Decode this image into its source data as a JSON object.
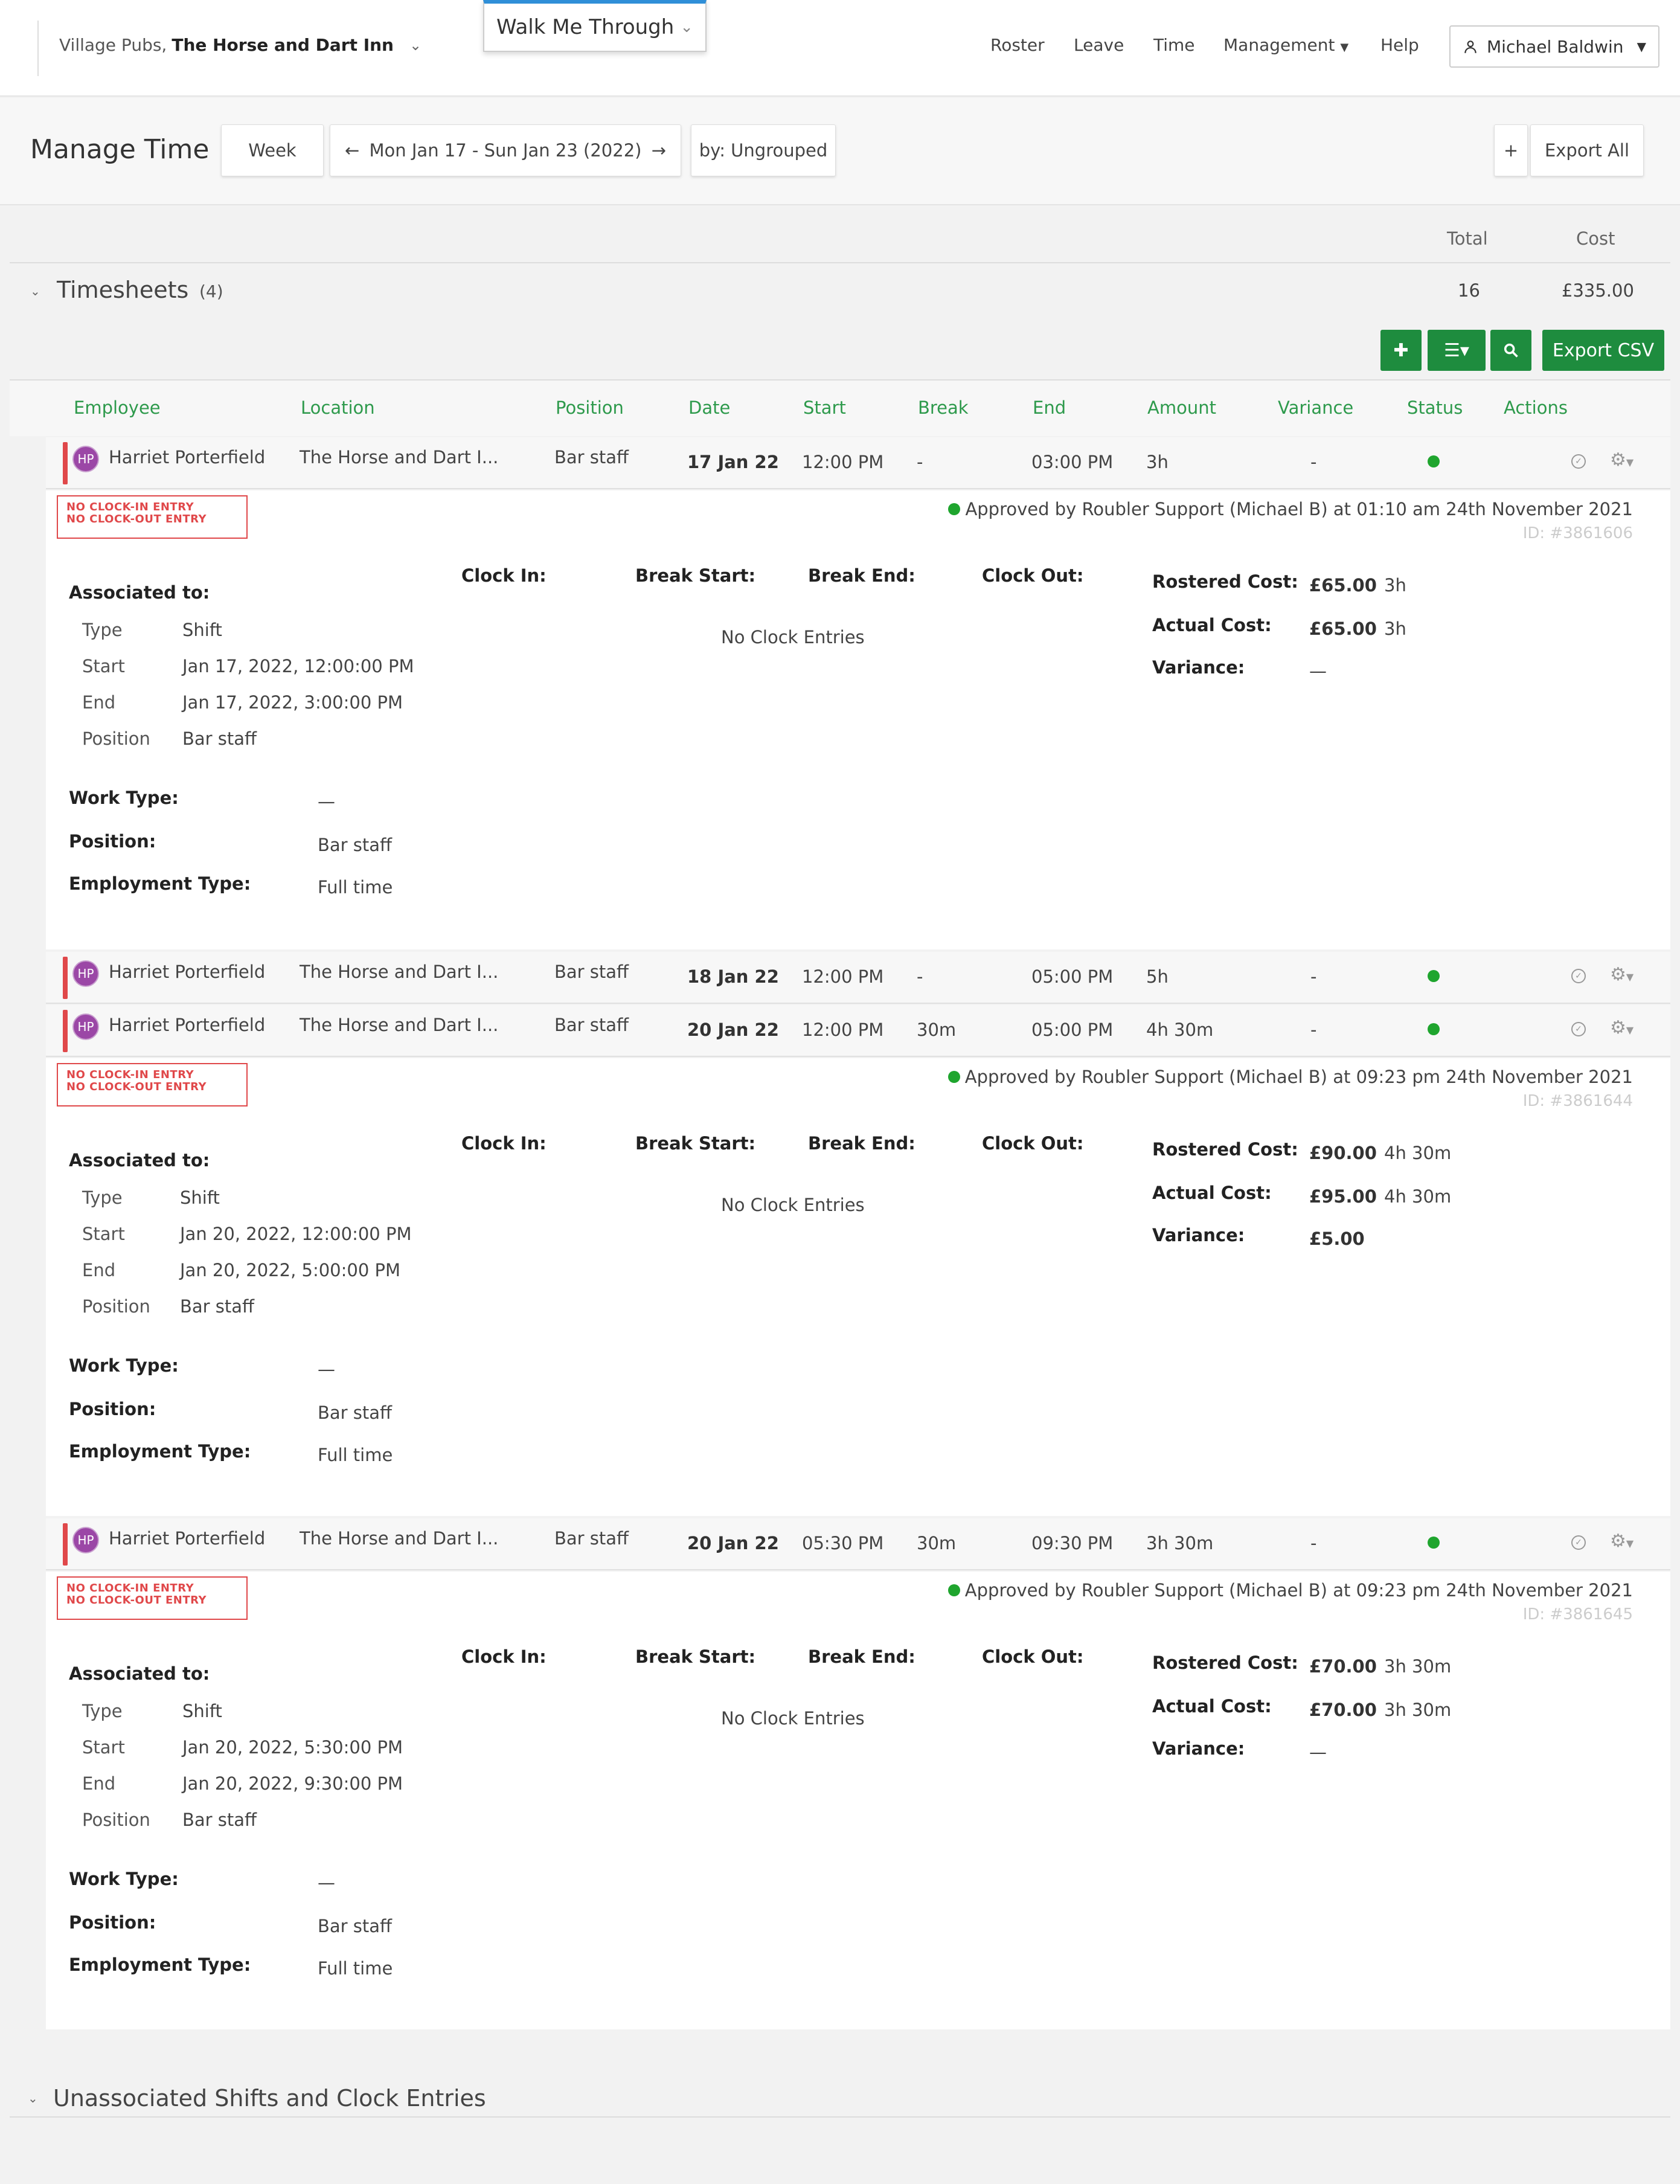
{
  "topnav": {
    "org_prefix": "Village Pubs,",
    "org_name": "The Horse and Dart Inn",
    "walk_me": "Walk Me Through",
    "links": {
      "roster": "Roster",
      "leave": "Leave",
      "time": "Time",
      "management": "Management",
      "help": "Help"
    },
    "user": "Michael Baldwin"
  },
  "header": {
    "title": "Manage Time",
    "view": "Week",
    "date_range": "Mon Jan 17 - Sun Jan 23 (2022)",
    "group_by": "by: Ungrouped",
    "plus": "+",
    "export_all": "Export All"
  },
  "summary": {
    "total_label": "Total",
    "cost_label": "Cost",
    "section_title": "Timesheets",
    "count": "(4)",
    "total": "16",
    "cost": "£335.00",
    "export_csv": "Export CSV"
  },
  "columns": [
    "Employee",
    "Location",
    "Position",
    "Date",
    "Start",
    "Break",
    "End",
    "Amount",
    "Variance",
    "Status",
    "Actions"
  ],
  "rows": [
    {
      "initials": "HP",
      "employee": "Harriet Porterfield",
      "location": "The Horse and Dart I...",
      "position": "Bar staff",
      "date": "17 Jan 22",
      "start": "12:00 PM",
      "break": "-",
      "end": "03:00 PM",
      "amount": "3h",
      "variance": "-"
    },
    {
      "initials": "HP",
      "employee": "Harriet Porterfield",
      "location": "The Horse and Dart I...",
      "position": "Bar staff",
      "date": "18 Jan 22",
      "start": "12:00 PM",
      "break": "-",
      "end": "05:00 PM",
      "amount": "5h",
      "variance": "-"
    },
    {
      "initials": "HP",
      "employee": "Harriet Porterfield",
      "location": "The Horse and Dart I...",
      "position": "Bar staff",
      "date": "20 Jan 22",
      "start": "12:00 PM",
      "break": "30m",
      "end": "05:00 PM",
      "amount": "4h 30m",
      "variance": "-"
    },
    {
      "initials": "HP",
      "employee": "Harriet Porterfield",
      "location": "The Horse and Dart I...",
      "position": "Bar staff",
      "date": "20 Jan 22",
      "start": "05:30 PM",
      "break": "30m",
      "end": "09:30 PM",
      "amount": "3h 30m",
      "variance": "-"
    }
  ],
  "details": [
    {
      "badge1": "NO CLOCK-IN ENTRY",
      "badge2": "NO CLOCK-OUT ENTRY",
      "approved": "Approved by Roubler Support (Michael B) at 01:10 am 24th November 2021",
      "id": "ID: #3861606",
      "assoc_type": "Shift",
      "assoc_start": "Jan 17, 2022, 12:00:00 PM",
      "assoc_end": "Jan 17, 2022, 3:00:00 PM",
      "assoc_position": "Bar staff",
      "work_type": "—",
      "position": "Bar staff",
      "employment_type": "Full time",
      "rostered_cost": "£65.00",
      "rostered_dur": "3h",
      "actual_cost": "£65.00",
      "actual_dur": "3h",
      "variance": "—"
    },
    {
      "badge1": "NO CLOCK-IN ENTRY",
      "badge2": "NO CLOCK-OUT ENTRY",
      "approved": "Approved by Roubler Support (Michael B) at 09:23 pm 24th November 2021",
      "id": "ID: #3861644",
      "assoc_type": "Shift",
      "assoc_start": "Jan 20, 2022, 12:00:00 PM",
      "assoc_end": "Jan 20, 2022, 5:00:00 PM",
      "assoc_position": "Bar staff",
      "work_type": "—",
      "position": "Bar staff",
      "employment_type": "Full time",
      "rostered_cost": "£90.00",
      "rostered_dur": "4h 30m",
      "actual_cost": "£95.00",
      "actual_dur": "4h 30m",
      "variance": "£5.00"
    },
    {
      "badge1": "NO CLOCK-IN ENTRY",
      "badge2": "NO CLOCK-OUT ENTRY",
      "approved": "Approved by Roubler Support (Michael B) at 09:23 pm 24th November 2021",
      "id": "ID: #3861645",
      "assoc_type": "Shift",
      "assoc_start": "Jan 20, 2022, 5:30:00 PM",
      "assoc_end": "Jan 20, 2022, 9:30:00 PM",
      "assoc_position": "Bar staff",
      "work_type": "—",
      "position": "Bar staff",
      "employment_type": "Full time",
      "rostered_cost": "£70.00",
      "rostered_dur": "3h 30m",
      "actual_cost": "£70.00",
      "actual_dur": "3h 30m",
      "variance": "—"
    }
  ],
  "labels": {
    "associated_to": "Associated to:",
    "type": "Type",
    "start": "Start",
    "end": "End",
    "position": "Position",
    "clock_in": "Clock In:",
    "break_start": "Break Start:",
    "break_end": "Break End:",
    "clock_out": "Clock Out:",
    "no_clock_entries": "No Clock Entries",
    "rostered_cost": "Rostered Cost:",
    "actual_cost": "Actual Cost:",
    "variance": "Variance:",
    "work_type": "Work Type:",
    "position_field": "Position:",
    "employment_type": "Employment Type:"
  },
  "unassociated_title": "Unassociated Shifts and Clock Entries"
}
